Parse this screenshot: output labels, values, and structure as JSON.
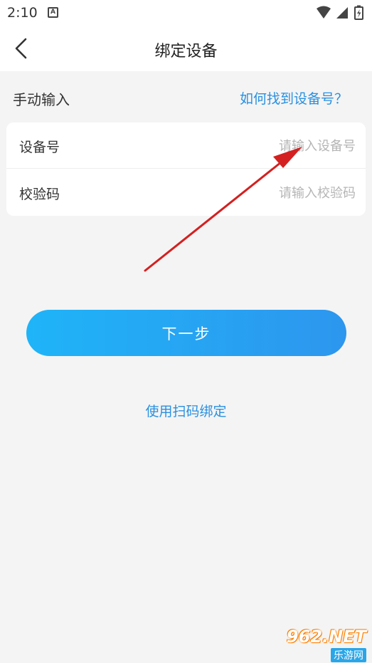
{
  "status_bar": {
    "time": "2:10",
    "icons": [
      "a-notification-icon",
      "wifi-icon",
      "signal-icon",
      "battery-icon"
    ]
  },
  "header": {
    "title": "绑定设备",
    "back_icon": "chevron-left-icon"
  },
  "section": {
    "title": "手动输入",
    "help_link": "如何找到设备号？"
  },
  "form": {
    "device_label": "设备号",
    "device_placeholder": "请输入设备号",
    "device_value": "",
    "code_label": "校验码",
    "code_placeholder": "请输入校验码",
    "code_value": ""
  },
  "actions": {
    "next_label": "下一步",
    "scan_link": "使用扫码绑定"
  },
  "colors": {
    "accent": "#2a90e0",
    "button_gradient_start": "#1fb4f8",
    "button_gradient_end": "#2d96ee",
    "background": "#f4f4f4",
    "annotation_arrow": "#d42020"
  },
  "watermark": {
    "main": "962.NET",
    "sub": "乐游网"
  }
}
